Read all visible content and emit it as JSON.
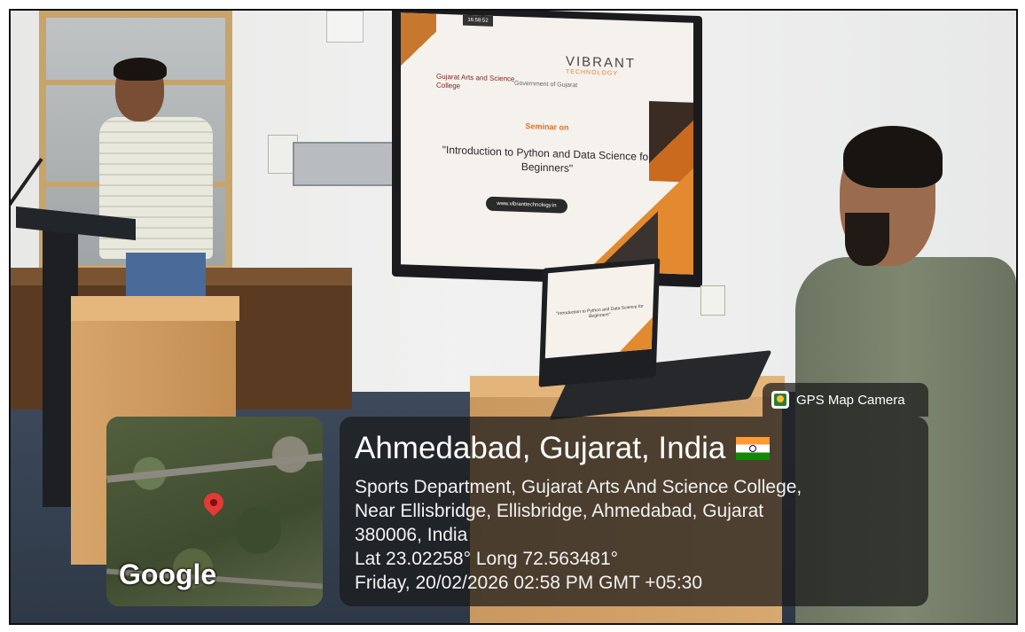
{
  "scene": {
    "screen_slide": {
      "timer": "16:58:52",
      "brand": "VIBRANT",
      "brand_sub": "TECHNOLOGY",
      "college": "Gujarat Arts and Science College",
      "government": "Government of Gujarat",
      "seminar_label": "Seminar on",
      "title": "\"Introduction to Python and Data Science for Beginners\"",
      "url": "www.vibranttechnology.in"
    },
    "laptop_slide": {
      "title": "\"Introduction to Python and Data Science for Beginners\""
    }
  },
  "overlay": {
    "app_badge": "GPS Map Camera",
    "map_watermark": "Google",
    "location_title": "Ahmedabad, Gujarat, India",
    "address_line1": "Sports Department, Gujarat Arts And Science College,",
    "address_line2": "Near Ellisbridge, Ellisbridge, Ahmedabad, Gujarat",
    "address_line3": "380006, India",
    "coordinates": "Lat 23.02258° Long 72.563481°",
    "datetime": "Friday, 20/02/2026 02:58 PM GMT +05:30",
    "flag_icon": "india-flag-icon",
    "pin_icon": "map-pin-icon",
    "badge_icon": "gps-camera-icon"
  }
}
